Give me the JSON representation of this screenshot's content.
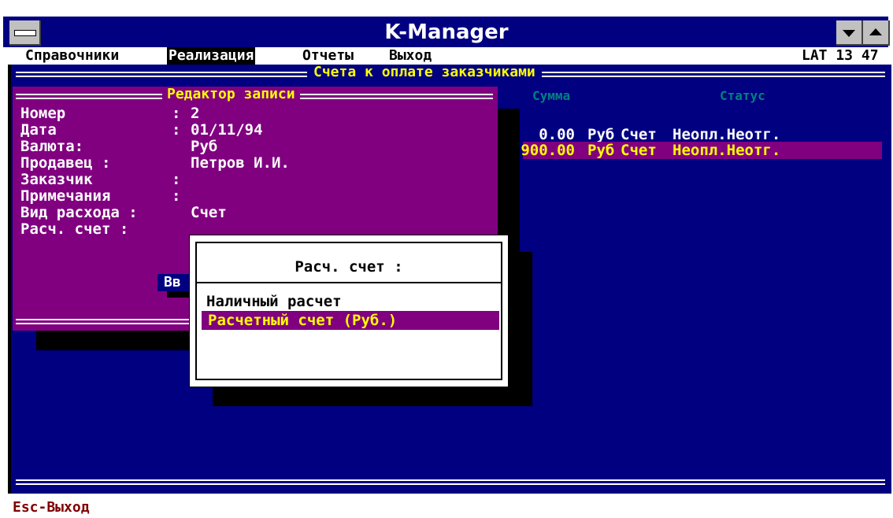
{
  "window": {
    "title": "K-Manager"
  },
  "menubar": {
    "items": [
      "Справочники",
      "Реализация",
      "Отчеты",
      "Выход"
    ],
    "active_index": 1,
    "indicator": "LAT 13 47"
  },
  "list": {
    "title": "Счета к оплате заказчиками",
    "columns": [
      "Сумма",
      "Статус"
    ],
    "rows": [
      {
        "amount": "0.00",
        "currency": "Руб",
        "type": "Счет",
        "status": "Неопл.Неотг.",
        "selected": false
      },
      {
        "amount": "900.00",
        "currency": "Руб",
        "type": "Счет",
        "status": "Неопл.Неотг.",
        "selected": true
      }
    ]
  },
  "editor": {
    "title": "Редактор записи",
    "fields": [
      {
        "label": "Номер",
        "colon": ":",
        "value": "2"
      },
      {
        "label": "Дата",
        "colon": ":",
        "value": "01/11/94"
      },
      {
        "label": "Валюта:",
        "colon": "",
        "value": "Руб"
      },
      {
        "label": "Продавец :",
        "colon": "",
        "value": "Петров И.И."
      },
      {
        "label": "Заказчик",
        "colon": ":",
        "value": ""
      },
      {
        "label": "Примечания",
        "colon": ":",
        "value": ""
      },
      {
        "label": "Вид расхода :",
        "colon": "",
        "value": "Счет"
      },
      {
        "label": "Расч. счет :",
        "colon": "",
        "value": ""
      }
    ],
    "button_partial": "Вв"
  },
  "popup": {
    "title": "Расч. счет :",
    "options": [
      "Наличный расчет",
      "Расчетный счет (Руб.)"
    ],
    "selected_index": 1
  },
  "statusbar": {
    "text": "Esc-Выход"
  },
  "colors": {
    "navy": "#000080",
    "purple": "#800080",
    "yellow": "#ffff00",
    "teal": "#008080",
    "maroon": "#800000"
  },
  "icons": [
    "system-menu-icon",
    "minimize-arrow-icon",
    "maximize-arrow-icon"
  ]
}
